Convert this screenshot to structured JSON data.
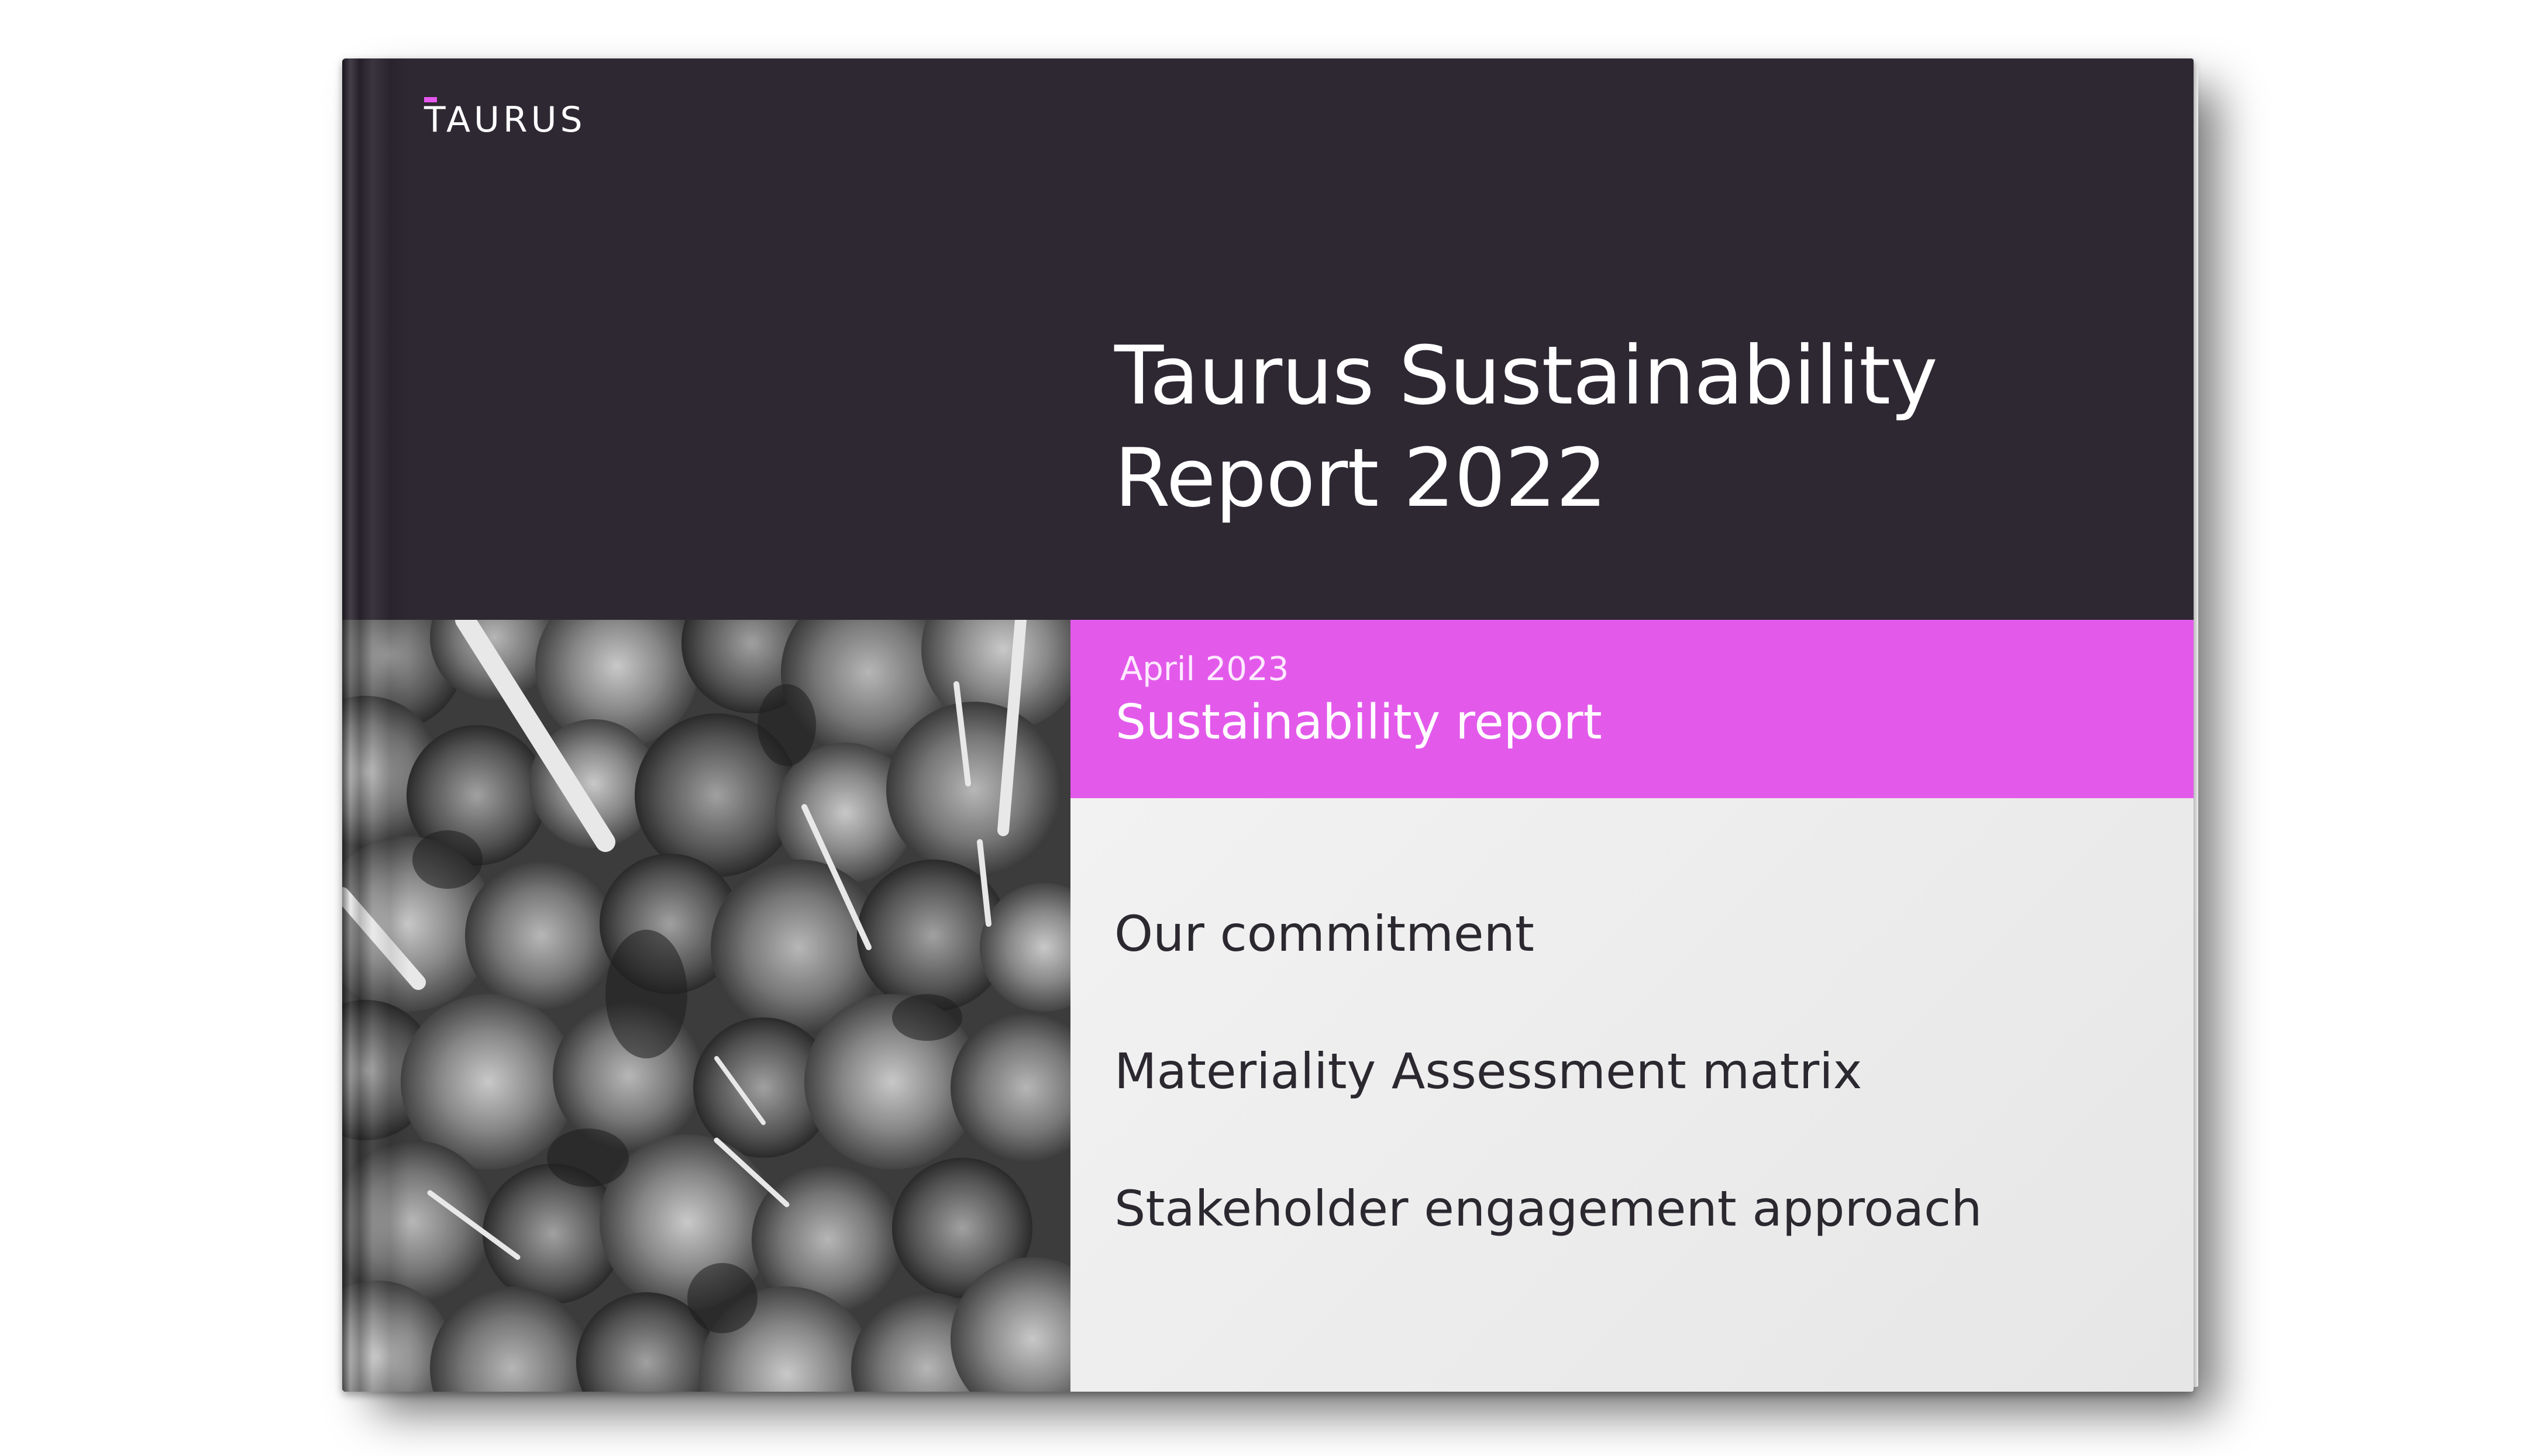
{
  "brand": {
    "logo_text": "TAURUS",
    "accent_color": "#e556ee"
  },
  "cover": {
    "title_line1": "Taurus Sustainability",
    "title_line2": "Report 2022",
    "date": "April 2023",
    "subtitle": "Sustainability report",
    "top_panel_color": "#2e2833",
    "band_color": "#e35aeb"
  },
  "contents": {
    "items": [
      "Our commitment",
      "Materiality Assessment matrix",
      "Stakeholder engagement approach"
    ]
  },
  "image": {
    "subject": "forest-canopy-photo",
    "style": "black-and-white aerial"
  }
}
